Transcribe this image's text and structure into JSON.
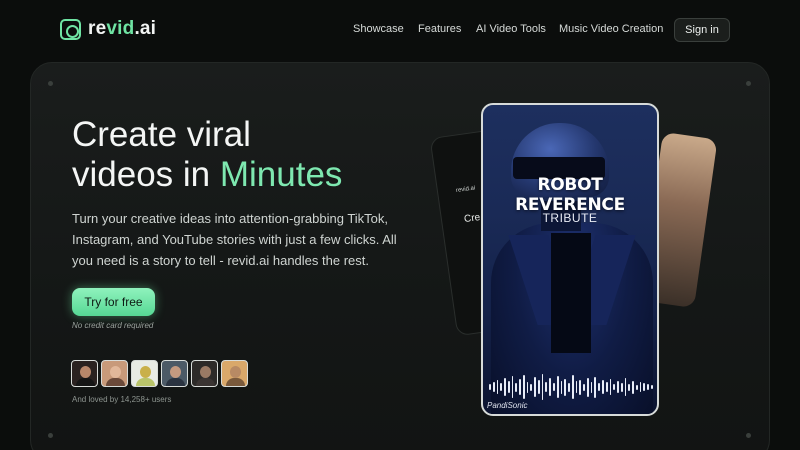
{
  "logo": {
    "prefix": "re",
    "accent": "vid",
    "suffix": ".ai"
  },
  "nav": {
    "links": [
      "Showcase",
      "Features",
      "AI Video Tools",
      "Music Video Creation"
    ],
    "signin": "Sign in"
  },
  "hero": {
    "headline_line1": "Create viral",
    "headline_line2_plain": "videos in ",
    "headline_line2_accent": "Minutes",
    "subtext": "Turn your creative ideas into attention-grabbing TikTok, Instagram, and YouTube stories with just a few clicks. All you need is a story to tell - revid.ai handles the rest.",
    "cta": "Try for free",
    "cta_note": "No credit card required",
    "loved": "And loved by 14,258+ users"
  },
  "preview": {
    "title": "ROBOT REVERENCE",
    "subtitle": "TRIBUTE",
    "brand": "PandiSonic",
    "back_card_logo": "revid.ai",
    "back_card_text": "Cre video"
  },
  "colors": {
    "accent": "#7ee8b0",
    "background": "#0b0d0c"
  }
}
